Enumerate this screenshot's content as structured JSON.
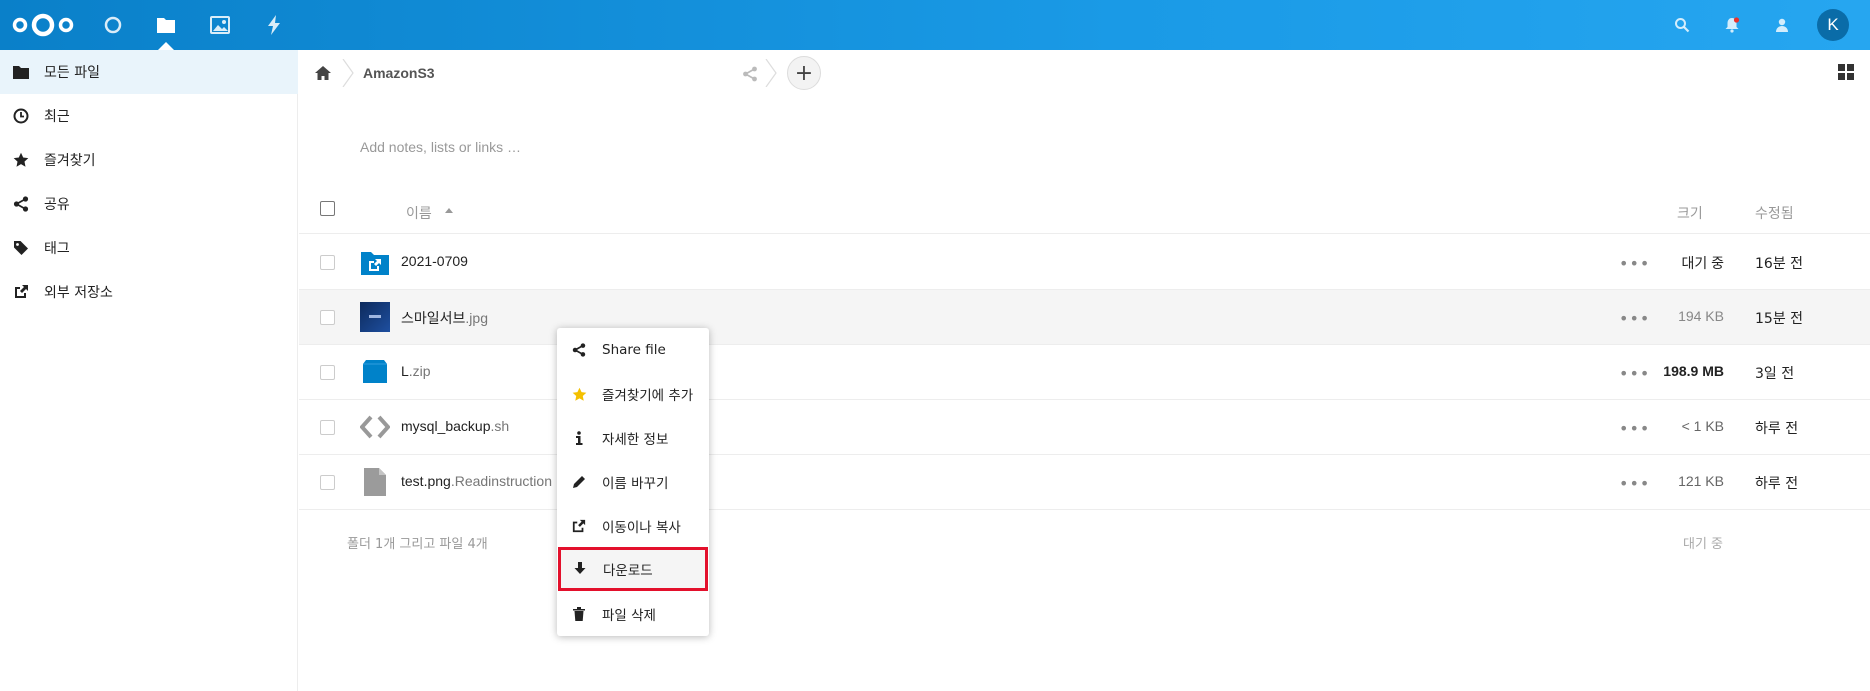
{
  "header": {
    "apps": [
      {
        "name": "dashboard",
        "icon": "circle-icon"
      },
      {
        "name": "files",
        "icon": "folder-icon"
      },
      {
        "name": "photos",
        "icon": "image-icon"
      },
      {
        "name": "activity",
        "icon": "lightning-icon"
      }
    ],
    "avatar_initial": "K",
    "brand_color": "#1a9ae6"
  },
  "sidebar": {
    "items": [
      {
        "label": "모든 파일",
        "icon": "folder-icon",
        "active": true
      },
      {
        "label": "최근",
        "icon": "clock-icon"
      },
      {
        "label": "즐겨찾기",
        "icon": "star-icon"
      },
      {
        "label": "공유",
        "icon": "share-icon"
      },
      {
        "label": "태그",
        "icon": "tag-icon"
      },
      {
        "label": "외부 저장소",
        "icon": "external-link-icon"
      }
    ]
  },
  "breadcrumb": {
    "folder": "AmazonS3",
    "add_label": "+"
  },
  "notes": {
    "placeholder": "Add notes, lists or links …"
  },
  "table": {
    "headers": {
      "name": "이름",
      "size": "크기",
      "modified": "수정됨"
    },
    "rows": [
      {
        "base": "2021-0709",
        "ext": "",
        "size": "대기 중",
        "modified": "16분 전",
        "icon": "external-folder-icon",
        "size_bold": false
      },
      {
        "base": "스마일서브",
        "ext": ".jpg",
        "size": "194 KB",
        "modified": "15분 전",
        "icon": "image-thumbnail-icon",
        "size_bold": false
      },
      {
        "base": "L",
        "ext": ".zip",
        "size": "198.9 MB",
        "modified": "3일 전",
        "icon": "archive-icon",
        "size_bold": true
      },
      {
        "base": "mysql_backup",
        "ext": ".sh",
        "size": "< 1 KB",
        "modified": "하루 전",
        "icon": "code-icon",
        "size_bold": false
      },
      {
        "base": "test.png",
        "ext": ".Readinstruction",
        "size": "121 KB",
        "modified": "하루 전",
        "icon": "file-icon",
        "size_bold": false
      }
    ],
    "summary": "폴더 1개 그리고 파일 4개",
    "summary_size": "대기 중"
  },
  "context_menu": {
    "items": [
      {
        "label": "Share file",
        "icon": "share-icon"
      },
      {
        "label": "즐겨찾기에 추가",
        "icon": "star-icon"
      },
      {
        "label": "자세한 정보",
        "icon": "info-icon"
      },
      {
        "label": "이름 바꾸기",
        "icon": "pencil-icon"
      },
      {
        "label": "이동이나 복사",
        "icon": "move-icon"
      },
      {
        "label": "다운로드",
        "icon": "download-icon",
        "highlighted": true
      },
      {
        "label": "파일 삭제",
        "icon": "trash-icon"
      }
    ],
    "highlight_color": "#e3102c"
  }
}
